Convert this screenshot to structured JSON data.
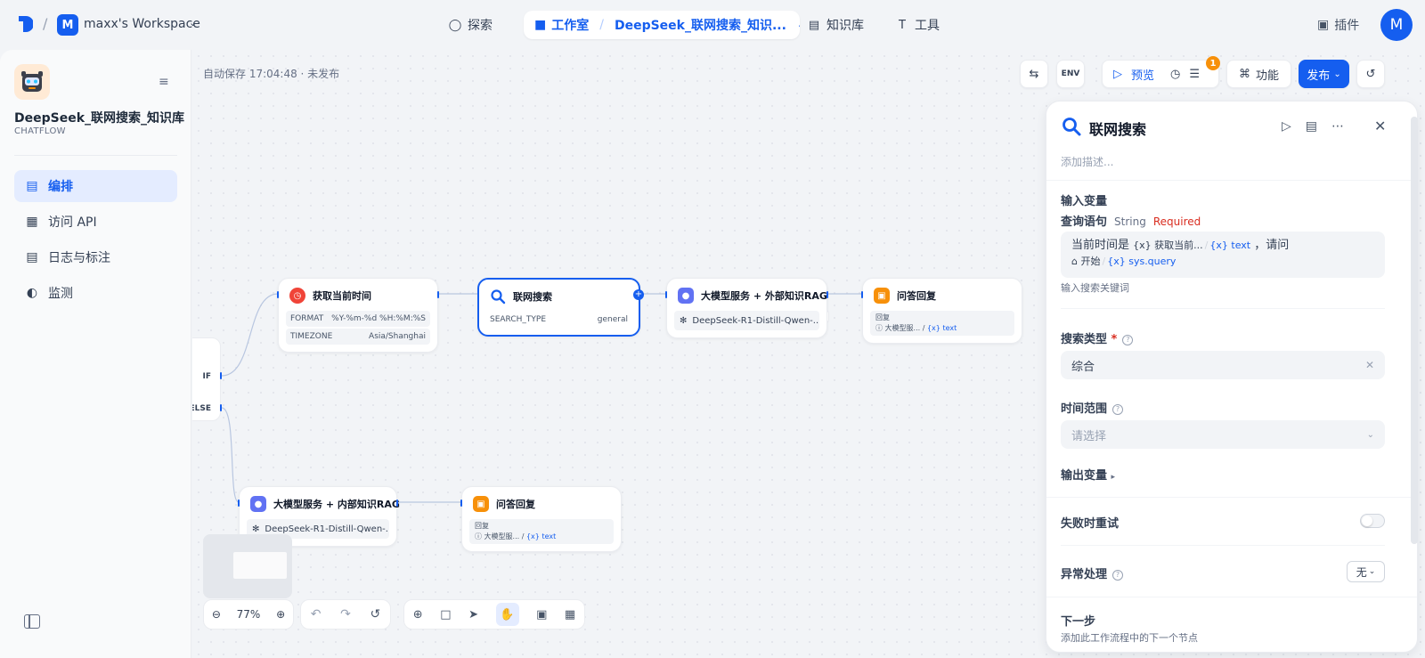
{
  "topbar": {
    "workspace_initial": "M",
    "workspace_name": "maxx's Workspace",
    "nav": {
      "explore": "探索",
      "studio": "工作室",
      "current_app": "DeepSeek_联网搜索_知识...",
      "knowledge": "知识库",
      "tools": "工具"
    },
    "plugins": "插件",
    "user_initial": "M"
  },
  "sidebar": {
    "app_title": "DeepSeek_联网搜索_知识库",
    "app_type": "CHATFLOW",
    "items": [
      {
        "label": "编排",
        "icon": "layout-icon",
        "active": true
      },
      {
        "label": "访问 API",
        "icon": "terminal-icon",
        "active": false
      },
      {
        "label": "日志与标注",
        "icon": "log-icon",
        "active": false
      },
      {
        "label": "监测",
        "icon": "monitor-icon",
        "active": false
      }
    ]
  },
  "canvas": {
    "autosave": "自动保存 17:04:48 · 未发布",
    "toolbar": {
      "preview": "预览",
      "checklist_badge": "1",
      "features": "功能",
      "publish": "发布"
    },
    "zoom": "77%",
    "reset_hint": "Reset Flow"
  },
  "nodes": {
    "if_else": {
      "if_label": "IF",
      "else_label": "ELSE"
    },
    "get_time": {
      "title": "获取当前时间",
      "params": [
        {
          "key": "FORMAT",
          "value": "%Y-%m-%d %H:%M:%S"
        },
        {
          "key": "TIMEZONE",
          "value": "Asia/Shanghai"
        }
      ]
    },
    "web_search": {
      "title": "联网搜索",
      "param_key": "SEARCH_TYPE",
      "param_value": "general"
    },
    "llm_external": {
      "title": "大模型服务 + 外部知识RAG",
      "model": "DeepSeek-R1-Distill-Qwen-..."
    },
    "answer_1": {
      "title": "问答回复",
      "label": "回复",
      "ref_node": "大模型服...",
      "ref_var": "text"
    },
    "llm_internal": {
      "title": "大模型服务 + 内部知识RAG",
      "model": "DeepSeek-R1-Distill-Qwen-..."
    },
    "answer_2": {
      "title": "问答回复",
      "label": "回复",
      "ref_node": "大模型服...",
      "ref_var": "text"
    }
  },
  "panel": {
    "title": "联网搜索",
    "desc_placeholder": "添加描述...",
    "input_vars": "输入变量",
    "query_name": "查询语句",
    "query_type": "String",
    "query_required": "Required",
    "query_text_1": "当前时间是",
    "query_chip1_node": "获取当前...",
    "query_chip1_var": "text",
    "query_text_2": "，请问",
    "query_chip2_node": "开始",
    "query_chip2_var": "sys.query",
    "query_hint": "输入搜索关键词",
    "search_type_label": "搜索类型",
    "search_type_value": "综合",
    "time_range_label": "时间范围",
    "time_range_placeholder": "请选择",
    "output_vars": "输出变量",
    "retry_label": "失败时重试",
    "error_label": "异常处理",
    "error_value": "无",
    "next_label": "下一步",
    "next_desc": "添加此工作流程中的下一个节点"
  }
}
